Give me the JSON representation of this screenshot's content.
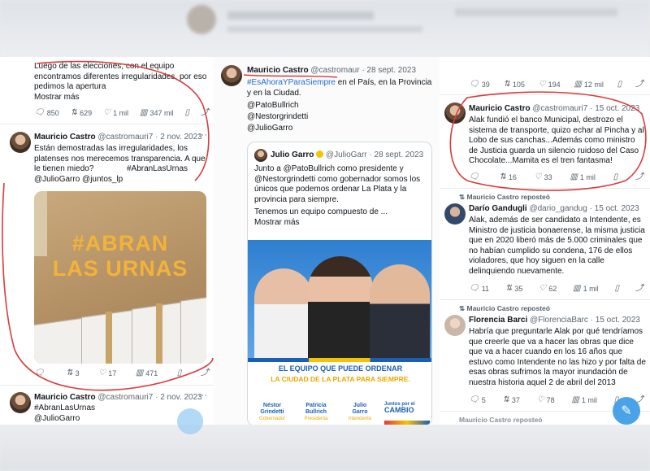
{
  "col1": {
    "top_text": "Luego de las elecciones, con el equipo encontramos diferentes irregularidades, por eso pedimos la apertura",
    "show_more": "Mostrar más",
    "top_actions": {
      "replies": "850",
      "reposts": "629",
      "likes": "1 mil",
      "views": "347 mil"
    },
    "tweet": {
      "name": "Mauricio Castro",
      "handle": "@castromauri7",
      "date": "· 2 nov. 2023",
      "text": "Están demostradas las irregularidades, los platenses nos merecemos transparencia. A que le tienen miedo?",
      "hashtag": "#AbranLasUrnas",
      "mentions": "@JulioGarro @juntos_lp",
      "image_line1": "#ABRAN",
      "image_line2": "LAS URNAS",
      "actions": {
        "replies": "",
        "reposts": "3",
        "likes": "17",
        "views": "471"
      }
    },
    "tweet2": {
      "name": "Mauricio Castro",
      "handle": "@castromauri7",
      "date": "· 2 nov. 2023",
      "hashtag": "#AbranLasUrnas",
      "mention": "@JulioGarro"
    }
  },
  "col2": {
    "tweet": {
      "name": "Mauricio Castro",
      "handle": "@castromaur",
      "date": "· 28 sept. 2023",
      "hashtag": "#EsAhoraYParaSiempre",
      "text_after": " en el País, en la Provincia y en la Ciudad.",
      "mentions": [
        "@PatoBullrich",
        "@Nestorgrindetti",
        "@JulioGarro"
      ]
    },
    "quoted": {
      "name": "Julio Garro",
      "handle": "@JulioGarr",
      "date": "· 28 sept. 2023",
      "text": "Junto a @PatoBullrich como presidente y @Nestorgrindetti como gobernador somos los únicos que podemos ordenar La Plata y la provincia para siempre.",
      "text2": "Tenemos un equipo compuesto de ...",
      "show_more": "Mostrar más",
      "poster_line1": "EL EQUIPO QUE PUEDE ORDENAR",
      "poster_line2": "LA CIUDAD DE LA PLATA PARA SIEMPRE.",
      "candidates": [
        {
          "first": "Néstor",
          "last": "Grindetti",
          "role": "Gobernador"
        },
        {
          "first": "Patricia",
          "last": "Bullrich",
          "role": "Presidenta"
        },
        {
          "first": "Julio",
          "last": "Garro",
          "role": "Intendente"
        }
      ],
      "logo_top": "Juntos por el",
      "logo_main": "CAMBIO"
    }
  },
  "col3": {
    "top_actions": {
      "replies": "39",
      "reposts": "105",
      "likes": "194",
      "views": "12 mil"
    },
    "tweet1": {
      "name": "Mauricio Castro",
      "handle": "@castromauri7",
      "date": "· 15 oct. 2023",
      "text": "Alak fundió el banco Municipal, destrozo el sistema de transporte, quizo echar al Pincha y al Lobo de sus canchas...Además como ministro de Justicia guarda un silencio ruidoso del Caso Chocolate...Mamita es el tren fantasma!",
      "actions": {
        "replies": "",
        "reposts": "16",
        "likes": "33",
        "views": "1 mil"
      }
    },
    "tweet2": {
      "reposted": "Mauricio Castro reposteó",
      "name": "Darío Gandugli",
      "handle": "@dario_gandug",
      "date": "· 15 oct. 2023",
      "text": "Alak, además de ser candidato a Intendente, es Ministro de justicia bonaerense, la misma justicia que en 2020 liberó más de 5.000 criminales que no habían cumplido su condena, 176 de ellos violadores, que hoy siguen en la calle delinquiendo nuevamente.",
      "actions": {
        "replies": "11",
        "reposts": "35",
        "likes": "62",
        "views": "1 mil"
      }
    },
    "tweet3": {
      "reposted": "Mauricio Castro reposteó",
      "name": "Florencia Barci",
      "handle": "@FlorenciaBarc",
      "date": "· 15 oct. 2023",
      "text": "Habría que preguntarle Alak por qué tendríamos que creerle que va a hacer las obras que dice que va a hacer cuando en los 16 años que estuvo como Intendente no las hizo y por falta de esas obras sufrimos la mayor inundación de nuestra historia aquel 2 de abril del 2013",
      "actions": {
        "replies": "5",
        "reposts": "37",
        "likes": "78",
        "views": "1 mil"
      }
    },
    "bottom_reposted": "Mauricio Castro reposteó"
  },
  "icons": [
    "reply-icon",
    "repost-icon",
    "like-icon",
    "views-icon",
    "bookmark-icon",
    "share-icon",
    "more-icon",
    "verified-icon",
    "compose-icon"
  ],
  "colors": {
    "link": "#1d6fd1",
    "annotation": "#d93b3b",
    "brand_blue": "#1b5fb4",
    "brand_yellow": "#f2b33a"
  }
}
